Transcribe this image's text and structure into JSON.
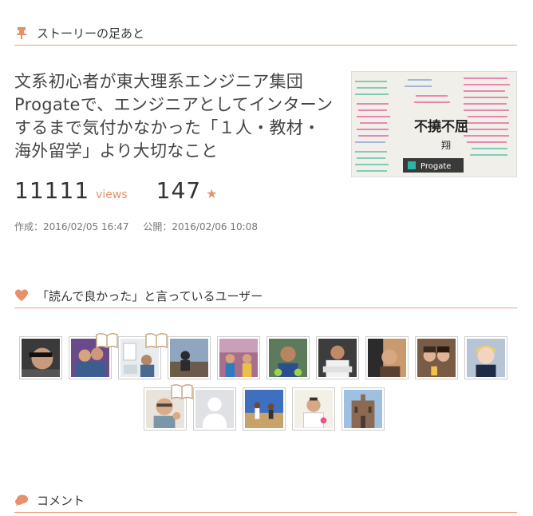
{
  "story_section": {
    "title": "ストーリーの足あと",
    "icon": "pin-icon"
  },
  "story": {
    "title": "文系初心者が東大理系エンジニア集団Progateで、エンジニアとしてインターンするまで気付かなかった「１人・教材・海外留学」より大切なこと",
    "views": "11111",
    "views_label": "views",
    "stars": "147",
    "created": "作成：2016/02/05 16:47",
    "published": "公開：2016/02/06 10:08",
    "thumbnail_text": {
      "main": "不撓不屈",
      "sub": "翔",
      "brand": "Progate"
    }
  },
  "likes_section": {
    "title": "「読んで良かった」と言っているユーザー",
    "icon": "heart-icon"
  },
  "users": [
    {
      "name": "user-1",
      "book": false
    },
    {
      "name": "user-2",
      "book": true
    },
    {
      "name": "user-3",
      "book": true
    },
    {
      "name": "user-4",
      "book": false
    },
    {
      "name": "user-5",
      "book": false
    },
    {
      "name": "user-6",
      "book": false
    },
    {
      "name": "user-7",
      "book": false
    },
    {
      "name": "user-8",
      "book": false
    },
    {
      "name": "user-9",
      "book": false
    },
    {
      "name": "user-10",
      "book": false
    },
    {
      "name": "user-11",
      "book": true
    },
    {
      "name": "user-12",
      "book": false
    },
    {
      "name": "user-13",
      "book": false
    },
    {
      "name": "user-14",
      "book": false
    },
    {
      "name": "user-15",
      "book": false
    }
  ],
  "comment_section": {
    "title": "コメント",
    "icon": "speech-bubble-icon"
  },
  "colors": {
    "accent": "#e8906a",
    "divider": "#e8a27c"
  }
}
